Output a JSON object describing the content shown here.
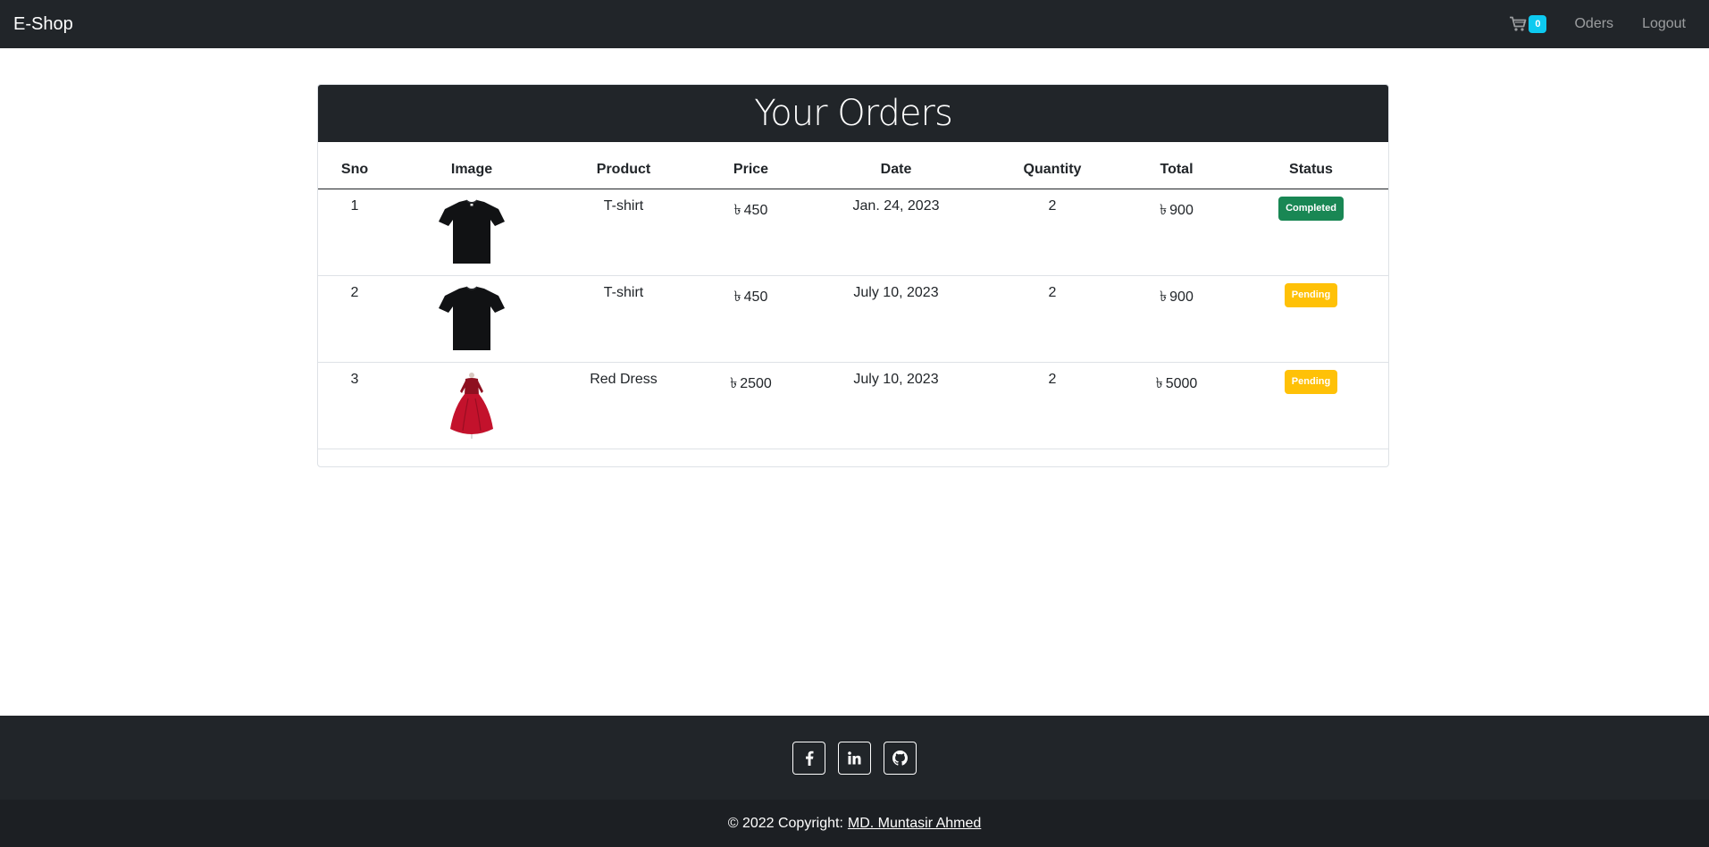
{
  "navbar": {
    "brand": "E-Shop",
    "cart_count": "0",
    "links": [
      "Oders",
      "Logout"
    ]
  },
  "orders": {
    "title": "Your Orders",
    "columns": [
      "Sno",
      "Image",
      "Product",
      "Price",
      "Date",
      "Quantity",
      "Total",
      "Status"
    ],
    "currency_symbol": "৳",
    "rows": [
      {
        "sno": "1",
        "image": "black-tshirt-image",
        "product": "T-shirt",
        "price": "450",
        "date": "Jan. 24, 2023",
        "quantity": "2",
        "total": "900",
        "status": "Completed",
        "status_color": "#198754"
      },
      {
        "sno": "2",
        "image": "black-tshirt-image",
        "product": "T-shirt",
        "price": "450",
        "date": "July 10, 2023",
        "quantity": "2",
        "total": "900",
        "status": "Pending",
        "status_color": "#ffc107"
      },
      {
        "sno": "3",
        "image": "red-dress-image",
        "product": "Red Dress",
        "price": "2500",
        "date": "July 10, 2023",
        "quantity": "2",
        "total": "5000",
        "status": "Pending",
        "status_color": "#ffc107"
      }
    ]
  },
  "footer": {
    "social": [
      "facebook-icon",
      "linkedin-icon",
      "github-icon"
    ],
    "copyright_prefix": "© 2022 Copyright:",
    "author": "MD. Muntasir Ahmed"
  },
  "colors": {
    "dark": "#212529",
    "info": "#0dcaf0",
    "success": "#198754",
    "warning": "#ffc107"
  }
}
